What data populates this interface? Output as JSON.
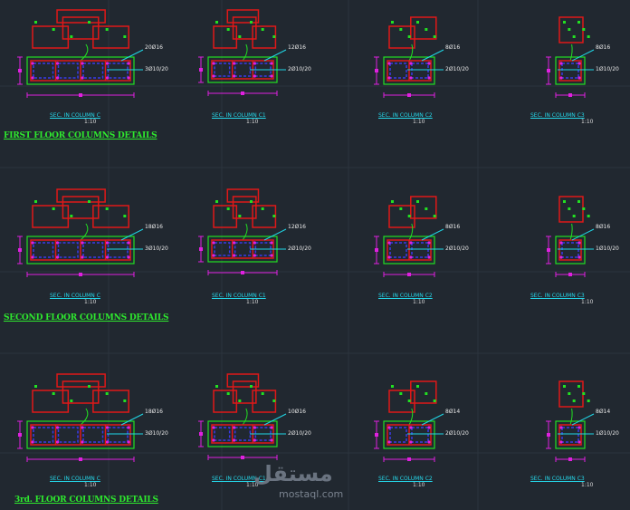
{
  "floors": [
    {
      "title": "FIRST FLOOR COLUMNS DETAILS",
      "details": [
        {
          "name": "SEC. IN COLUMN C",
          "scale": "1:10",
          "bar_text": "20Ø16",
          "stirrup_text": "3Ø10/20"
        },
        {
          "name": "SEC. IN COLUMN C1",
          "scale": "1:10",
          "bar_text": "12Ø16",
          "stirrup_text": "2Ø10/20"
        },
        {
          "name": "SEC. IN COLUMN C2",
          "scale": "1:10",
          "bar_text": "8Ø16",
          "stirrup_text": "2Ø10/20"
        },
        {
          "name": "SEC. IN COLUMN C3",
          "scale": "1:10",
          "bar_text": "8Ø16",
          "stirrup_text": "1Ø10/20"
        }
      ]
    },
    {
      "title": "SECOND FLOOR COLUMNS DETAILS",
      "details": [
        {
          "name": "SEC. IN COLUMN C",
          "scale": "1:10",
          "bar_text": "18Ø16",
          "stirrup_text": "3Ø10/20"
        },
        {
          "name": "SEC. IN COLUMN C1",
          "scale": "1:10",
          "bar_text": "12Ø16",
          "stirrup_text": "2Ø10/20"
        },
        {
          "name": "SEC. IN COLUMN C2",
          "scale": "1:10",
          "bar_text": "8Ø16",
          "stirrup_text": "2Ø10/20"
        },
        {
          "name": "SEC. IN COLUMN C3",
          "scale": "1:10",
          "bar_text": "8Ø16",
          "stirrup_text": "1Ø10/20"
        }
      ]
    },
    {
      "title": "3rd. FLOOR COLUMNS DETAILS",
      "details": [
        {
          "name": "SEC. IN COLUMN C",
          "scale": "1:10",
          "bar_text": "18Ø16",
          "stirrup_text": "3Ø10/20"
        },
        {
          "name": "SEC. IN COLUMN C1",
          "scale": "1:10",
          "bar_text": "10Ø16",
          "stirrup_text": "2Ø10/20"
        },
        {
          "name": "SEC. IN COLUMN C2",
          "scale": "1:10",
          "bar_text": "8Ø14",
          "stirrup_text": "2Ø10/20"
        },
        {
          "name": "SEC. IN COLUMN C3",
          "scale": "1:10",
          "bar_text": "8Ø14",
          "stirrup_text": "1Ø10/20"
        }
      ]
    }
  ],
  "watermark": {
    "arabic": "مستقل",
    "latin": "mostaql.com"
  },
  "colors": {
    "background": "#212830",
    "column_outline": "#22e022",
    "stirrup": "#e01818",
    "rebar": "#3a3ae8",
    "dimension": "#e020e0",
    "leader": "#20d8e8",
    "title": "#2ee82e"
  }
}
